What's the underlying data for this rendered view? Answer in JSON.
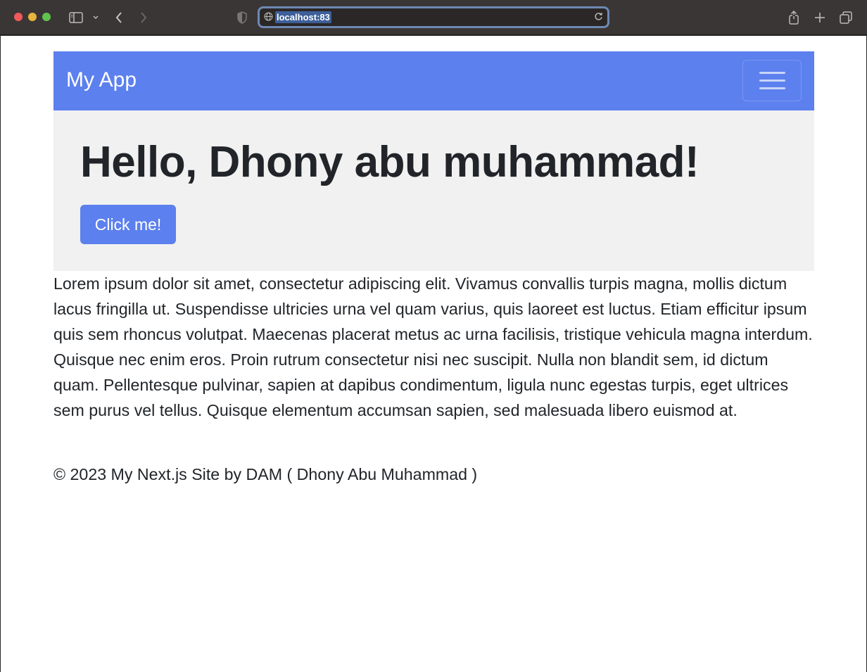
{
  "browser": {
    "url": "localhost:83",
    "icons": [
      "sidebar-icon",
      "chevron-down-icon",
      "back-icon",
      "forward-icon",
      "shield-icon",
      "globe-icon",
      "reload-icon",
      "share-icon",
      "new-tab-icon",
      "tabs-overview-icon"
    ]
  },
  "navbar": {
    "brand": "My App",
    "toggler_icon": "hamburger-menu-icon",
    "bg_color": "#5c80ee"
  },
  "hero": {
    "heading": "Hello, Dhony abu muhammad!",
    "button_label": "Click me!"
  },
  "content": {
    "paragraph": "Lorem ipsum dolor sit amet, consectetur adipiscing elit. Vivamus convallis turpis magna, mollis dictum lacus fringilla ut. Suspendisse ultricies urna vel quam varius, quis laoreet est luctus. Etiam efficitur ipsum quis sem rhoncus volutpat. Maecenas placerat metus ac urna facilisis, tristique vehicula magna interdum. Quisque nec enim eros. Proin rutrum consectetur nisi nec suscipit. Nulla non blandit sem, id dictum quam. Pellentesque pulvinar, sapien at dapibus condimentum, ligula nunc egestas turpis, eget ultrices sem purus vel tellus. Quisque elementum accumsan sapien, sed malesuada libero euismod at."
  },
  "footer": {
    "text": "© 2023 My Next.js Site by DAM ( Dhony Abu Muhammad )"
  }
}
